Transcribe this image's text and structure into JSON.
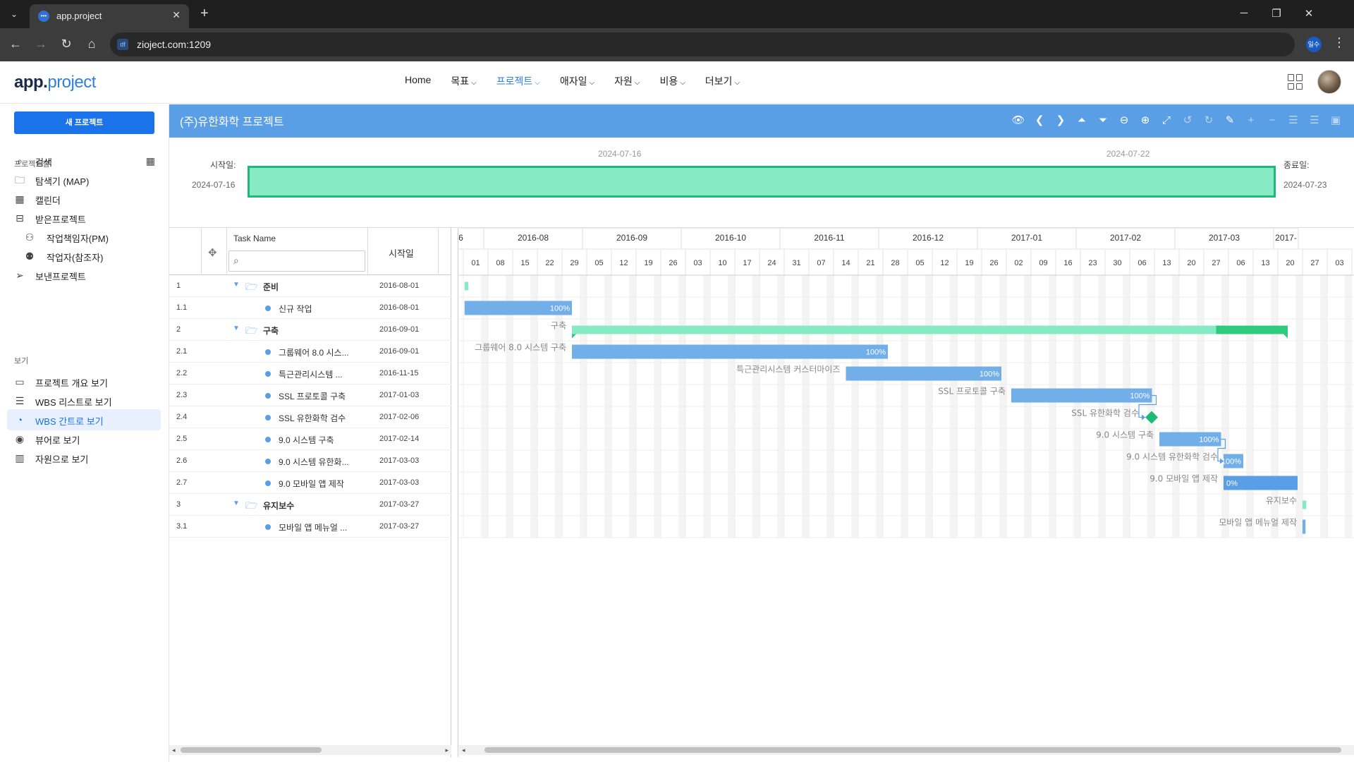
{
  "browser": {
    "tab_title": "app.project",
    "url": "zioject.com:1209",
    "profile": "일수"
  },
  "app": {
    "logo_a": "app.",
    "logo_b": "project",
    "nav": [
      {
        "label": "Home",
        "chevron": false,
        "active": false
      },
      {
        "label": "목표",
        "chevron": true,
        "active": false
      },
      {
        "label": "프로젝트",
        "chevron": true,
        "active": true
      },
      {
        "label": "애자일",
        "chevron": true,
        "active": false
      },
      {
        "label": "자원",
        "chevron": true,
        "active": false
      },
      {
        "label": "비용",
        "chevron": true,
        "active": false
      },
      {
        "label": "더보기",
        "chevron": true,
        "active": false
      }
    ]
  },
  "sidebar": {
    "new_button": "새 프로젝트",
    "section1": "프로젝트함",
    "section2": "보기",
    "items1": [
      {
        "label": "검색",
        "icon": "search-icon"
      },
      {
        "label": "탐색기 (MAP)",
        "icon": "folder-icon"
      },
      {
        "label": "캘린더",
        "icon": "calendar-icon"
      },
      {
        "label": "받은프로젝트",
        "icon": "inbox-icon"
      },
      {
        "label": "작업책임자(PM)",
        "icon": "user-icon"
      },
      {
        "label": "작업자(참조자)",
        "icon": "users-icon"
      },
      {
        "label": "보낸프로젝트",
        "icon": "send-icon"
      }
    ],
    "items2": [
      {
        "label": "프로젝트 개요 보기",
        "icon": "monitor-icon"
      },
      {
        "label": "WBS 리스트로 보기",
        "icon": "list-icon"
      },
      {
        "label": "WBS 간트로 보기",
        "icon": "pie-chart-icon",
        "active": true
      },
      {
        "label": "뷰어로 보기",
        "icon": "eye-icon"
      },
      {
        "label": "자원으로 보기",
        "icon": "bar-chart-icon"
      }
    ]
  },
  "main": {
    "title": "(주)유한화학 프로젝트",
    "summary": {
      "start_label": "시작일:",
      "start_date": "2024-07-16",
      "end_label": "종료일:",
      "end_date": "2024-07-23",
      "tick1": "2024-07-16",
      "tick2": "2024-07-22"
    },
    "grid": {
      "col_task": "Task Name",
      "col_start": "시작일"
    }
  },
  "tasks": [
    {
      "num": "1",
      "name": "준비",
      "start": "2016-08-01",
      "level": 0,
      "group": true
    },
    {
      "num": "1.1",
      "name": "신규 작업",
      "start": "2016-08-01",
      "level": 1,
      "group": false
    },
    {
      "num": "2",
      "name": "구축",
      "start": "2016-09-01",
      "level": 0,
      "group": true
    },
    {
      "num": "2.1",
      "name": "그룹웨어 8.0 시스...",
      "start": "2016-09-01",
      "level": 1,
      "group": false
    },
    {
      "num": "2.2",
      "name": "특근관리시스템 ...",
      "start": "2016-11-15",
      "level": 1,
      "group": false
    },
    {
      "num": "2.3",
      "name": "SSL 프로토콜 구축",
      "start": "2017-01-03",
      "level": 1,
      "group": false
    },
    {
      "num": "2.4",
      "name": "SSL 유한화학 검수",
      "start": "2017-02-06",
      "level": 1,
      "group": false
    },
    {
      "num": "2.5",
      "name": "9.0 시스템 구축",
      "start": "2017-02-14",
      "level": 1,
      "group": false
    },
    {
      "num": "2.6",
      "name": "9.0 시스템 유한화...",
      "start": "2017-03-03",
      "level": 1,
      "group": false
    },
    {
      "num": "2.7",
      "name": "9.0 모바일 앱 제작",
      "start": "2017-03-03",
      "level": 1,
      "group": false
    },
    {
      "num": "3",
      "name": "유지보수",
      "start": "2017-03-27",
      "level": 0,
      "group": true
    },
    {
      "num": "3.1",
      "name": "모바일 앱 메뉴얼 ...",
      "start": "2017-03-27",
      "level": 1,
      "group": false
    }
  ],
  "timeline": {
    "months": [
      {
        "label": "6",
        "days": 1
      },
      {
        "label": "2016-08",
        "days": 4
      },
      {
        "label": "2016-09",
        "days": 4
      },
      {
        "label": "2016-10",
        "days": 4
      },
      {
        "label": "2016-11",
        "days": 4
      },
      {
        "label": "2016-12",
        "days": 4
      },
      {
        "label": "2017-01",
        "days": 4
      },
      {
        "label": "2017-02",
        "days": 4
      },
      {
        "label": "2017-03",
        "days": 4
      },
      {
        "label": "2017-",
        "days": 1
      }
    ],
    "weeks": [
      "01",
      "08",
      "15",
      "22",
      "29",
      "05",
      "12",
      "19",
      "26",
      "03",
      "10",
      "17",
      "24",
      "31",
      "07",
      "14",
      "21",
      "28",
      "05",
      "12",
      "19",
      "26",
      "02",
      "09",
      "16",
      "23",
      "30",
      "06",
      "13",
      "20",
      "27",
      "06",
      "13",
      "20",
      "27",
      "03"
    ]
  },
  "bars": [
    {
      "row": 0,
      "type": "tiny-green",
      "start_week": 0.05,
      "end_week": 0.2
    },
    {
      "row": 1,
      "type": "task",
      "start_week": 0.05,
      "end_week": 4.4,
      "label": "100%",
      "progress": 1.0,
      "left_label": ""
    },
    {
      "row": 2,
      "type": "summary",
      "start_week": 4.4,
      "end_week": 33.4,
      "progress": 0.9,
      "left_label": "구축"
    },
    {
      "row": 3,
      "type": "task",
      "start_week": 4.4,
      "end_week": 17.2,
      "label": "100%",
      "progress": 1.0,
      "left_label": "그룹웨어 8.0 시스템 구축"
    },
    {
      "row": 4,
      "type": "task",
      "start_week": 15.5,
      "end_week": 21.8,
      "label": "100%",
      "progress": 1.0,
      "left_label": "특근관리시스템 커스터마이즈"
    },
    {
      "row": 5,
      "type": "task",
      "start_week": 22.2,
      "end_week": 27.9,
      "label": "100%",
      "progress": 1.0,
      "left_label": "SSL 프로토콜 구축"
    },
    {
      "row": 6,
      "type": "milestone",
      "start_week": 27.6,
      "end_week": 27.6,
      "left_label": "SSL 유한화학 검수"
    },
    {
      "row": 7,
      "type": "task",
      "start_week": 28.2,
      "end_week": 30.7,
      "label": "100%",
      "progress": 1.0,
      "left_label": "9.0 시스템 구축"
    },
    {
      "row": 8,
      "type": "task",
      "start_week": 30.8,
      "end_week": 31.6,
      "label": "100%",
      "progress": 1.0,
      "left_label": "9.0 시스템 유한화학 검수"
    },
    {
      "row": 9,
      "type": "task",
      "start_week": 30.8,
      "end_week": 33.8,
      "label": "0%",
      "progress": 0.0,
      "left_label": "9.0 모바일 앱 제작"
    },
    {
      "row": 10,
      "type": "tiny-green",
      "start_week": 34.0,
      "end_week": 34.15,
      "left_label": "유지보수"
    },
    {
      "row": 11,
      "type": "tiny-blue",
      "start_week": 34.0,
      "end_week": 34.12,
      "left_label": "모바일 앱 메뉴얼 제작"
    }
  ],
  "colors": {
    "header": "#5a9ee6",
    "task_bar": "#72aee8",
    "summary_bar": "#86ebc4",
    "summary_done": "#2ecb7c",
    "milestone": "#1eb979",
    "accent": "#1a73e8"
  }
}
